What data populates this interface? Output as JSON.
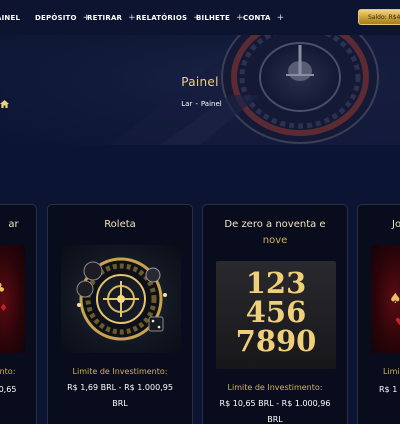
{
  "nav": {
    "items": [
      {
        "label": "AINEL",
        "has_plus": false
      },
      {
        "label": "DEPÓSITO",
        "has_plus": true
      },
      {
        "label": "RETIRAR",
        "has_plus": true
      },
      {
        "label": "RELATÓRIOS",
        "has_plus": true
      },
      {
        "label": "BILHETE",
        "has_plus": true
      },
      {
        "label": "CONTA",
        "has_plus": true
      }
    ],
    "plus_symbol": "+",
    "balance_label": "Saldo: R$49"
  },
  "hero": {
    "title": "Painel",
    "breadcrumb_home": "Lar",
    "breadcrumb_sep": "-",
    "breadcrumb_current": "Painel"
  },
  "cards": [
    {
      "title": "ar",
      "limit_label": "nto:",
      "range_line1": "0,65",
      "range_line2": ""
    },
    {
      "title": "Roleta",
      "limit_label": "Limite de Investimento:",
      "range_line1": "R$ 1,69 BRL - R$ 1.000,95",
      "range_line2": "BRL"
    },
    {
      "title_line1": "De zero a noventa e",
      "title_line2": "nove",
      "limit_label": "Limite de Investimento:",
      "range_line1": "R$ 10,65 BRL - R$ 1.000,96",
      "range_line2": "BRL",
      "image_numbers": [
        "123",
        "456",
        "7890"
      ]
    },
    {
      "title": "Jo",
      "limit_label": "Limi",
      "range_line1": "R$ 1",
      "range_line2": ""
    }
  ],
  "colors": {
    "gold": "#d3b15a",
    "background": "#0b1533",
    "card": "#080c1c"
  }
}
